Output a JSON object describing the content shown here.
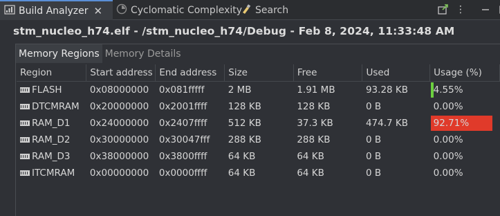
{
  "tabs": [
    {
      "label": "Build Analyzer",
      "active": true,
      "icon": "build-analyzer-icon"
    },
    {
      "label": "Cyclomatic Complexity",
      "active": false,
      "icon": "cyclomatic-complexity-icon"
    },
    {
      "label": "Search",
      "active": false,
      "icon": "search-icon"
    }
  ],
  "toolbar": {
    "icons": [
      "pin-view-icon",
      "view-menu-icon",
      "minimize-icon",
      "maximize-icon"
    ]
  },
  "title": "stm_nucleo_h74.elf - /stm_nucleo_h74/Debug - Feb 8, 2024, 11:33:48 AM",
  "subtabs": [
    "Memory Regions",
    "Memory Details"
  ],
  "table": {
    "columns": [
      "Region",
      "Start address",
      "End address",
      "Size",
      "Free",
      "Used",
      "Usage (%)"
    ],
    "rows": [
      {
        "region": "FLASH",
        "start": "0x08000000",
        "end": "0x081fffff",
        "size": "2 MB",
        "free": "1.91 MB",
        "used": "93.28 KB",
        "usage": "4.55%",
        "usage_value": 4.55
      },
      {
        "region": "DTCMRAM",
        "start": "0x20000000",
        "end": "0x2001ffff",
        "size": "128 KB",
        "free": "128 KB",
        "used": "0 B",
        "usage": "0.00%",
        "usage_value": 0
      },
      {
        "region": "RAM_D1",
        "start": "0x24000000",
        "end": "0x2407ffff",
        "size": "512 KB",
        "free": "37.3 KB",
        "used": "474.7 KB",
        "usage": "92.71%",
        "usage_value": 92.71
      },
      {
        "region": "RAM_D2",
        "start": "0x30000000",
        "end": "0x30047fff",
        "size": "288 KB",
        "free": "288 KB",
        "used": "0 B",
        "usage": "0.00%",
        "usage_value": 0
      },
      {
        "region": "RAM_D3",
        "start": "0x38000000",
        "end": "0x3800ffff",
        "size": "64 KB",
        "free": "64 KB",
        "used": "0 B",
        "usage": "0.00%",
        "usage_value": 0
      },
      {
        "region": "ITCMRAM",
        "start": "0x00000000",
        "end": "0x0000ffff",
        "size": "64 KB",
        "free": "64 KB",
        "used": "0 B",
        "usage": "0.00%",
        "usage_value": 0
      }
    ]
  },
  "colors": {
    "low_usage": "#6cd03f",
    "high_usage": "#e03a2a",
    "background": "#2f3136",
    "tab_accent": "#5a8fd6"
  }
}
